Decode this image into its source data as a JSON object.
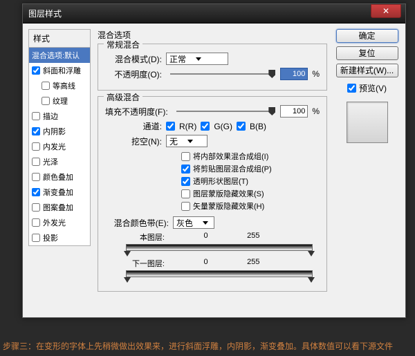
{
  "window": {
    "title": "图层样式"
  },
  "styles": {
    "panel_title": "样式",
    "items": [
      {
        "label": "混合选项:默认",
        "selected": true,
        "checkbox": false
      },
      {
        "label": "斜面和浮雕",
        "checked": true
      },
      {
        "label": "等高线",
        "indent": true,
        "checked": false
      },
      {
        "label": "纹理",
        "indent": true,
        "checked": false
      },
      {
        "label": "描边",
        "checked": false
      },
      {
        "label": "内阴影",
        "checked": true
      },
      {
        "label": "内发光",
        "checked": false
      },
      {
        "label": "光泽",
        "checked": false
      },
      {
        "label": "颜色叠加",
        "checked": false
      },
      {
        "label": "渐变叠加",
        "checked": true
      },
      {
        "label": "图案叠加",
        "checked": false
      },
      {
        "label": "外发光",
        "checked": false
      },
      {
        "label": "投影",
        "checked": false
      }
    ]
  },
  "main": {
    "heading": "混合选项",
    "general": {
      "title": "常规混合",
      "blend_mode_label": "混合模式(D):",
      "blend_mode_value": "正常",
      "opacity_label": "不透明度(O):",
      "opacity_value": "100",
      "opacity_unit": "%"
    },
    "advanced": {
      "title": "高级混合",
      "fill_label": "填充不透明度(F):",
      "fill_value": "100",
      "fill_unit": "%",
      "channels_label": "通道:",
      "ch_r": "R(R)",
      "ch_g": "G(G)",
      "ch_b": "B(B)",
      "knockout_label": "挖空(N):",
      "knockout_value": "无",
      "opts": [
        {
          "label": "将内部效果混合成组(I)",
          "checked": false
        },
        {
          "label": "将剪贴图层混合成组(P)",
          "checked": true
        },
        {
          "label": "透明形状图层(T)",
          "checked": true
        },
        {
          "label": "图层蒙版隐藏效果(S)",
          "checked": false
        },
        {
          "label": "矢量蒙版隐藏效果(H)",
          "checked": false
        }
      ],
      "blendif_label": "混合颜色带(E):",
      "blendif_value": "灰色",
      "this_label": "本图层:",
      "under_label": "下一图层:",
      "v0": "0",
      "v255": "255"
    }
  },
  "right": {
    "ok": "确定",
    "reset": "复位",
    "newstyle": "新建样式(W)...",
    "preview": "预览(V)"
  },
  "caption": "步骤三：在变形的字体上先稍微做出效果来，进行斜面浮雕，内阴影，渐变叠加。具体数值可以看下源文件"
}
